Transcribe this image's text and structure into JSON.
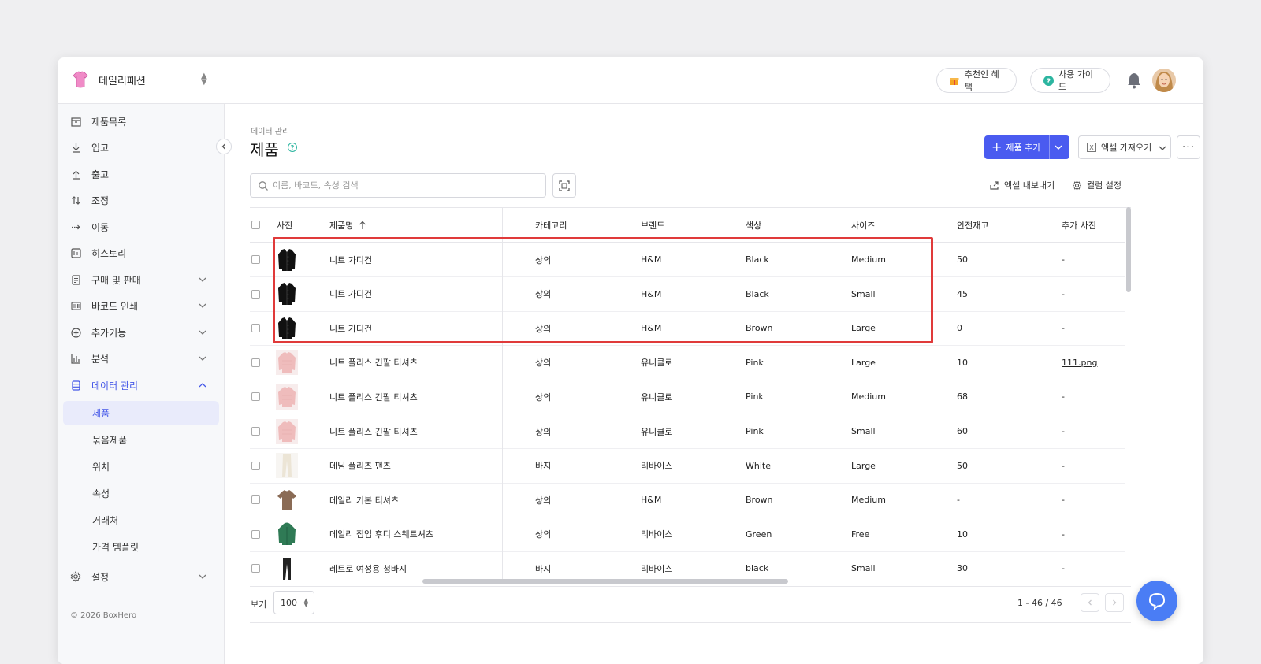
{
  "brand": {
    "name": "데일리패션"
  },
  "topbar": {
    "referral_label": "추천인 혜택",
    "guide_label": "사용 가이드"
  },
  "colors": {
    "accent": "#4a5bf0",
    "highlight": "#e03a3a",
    "help": "#2cb5a0"
  },
  "sidebar": {
    "items": [
      {
        "label": "제품목록",
        "icon": "box-icon"
      },
      {
        "label": "입고",
        "icon": "arrow-down-icon"
      },
      {
        "label": "출고",
        "icon": "arrow-up-icon"
      },
      {
        "label": "조정",
        "icon": "adjust-icon"
      },
      {
        "label": "이동",
        "icon": "move-icon"
      },
      {
        "label": "히스토리",
        "icon": "history-icon"
      },
      {
        "label": "구매 및 판매",
        "icon": "document-icon"
      },
      {
        "label": "바코드 인쇄",
        "icon": "barcode-icon"
      },
      {
        "label": "추가기능",
        "icon": "plus-circle-icon"
      },
      {
        "label": "분석",
        "icon": "chart-icon"
      },
      {
        "label": "데이터 관리",
        "icon": "database-icon"
      }
    ],
    "sub_items": [
      "제품",
      "묶음제품",
      "위치",
      "속성",
      "거래처",
      "가격 템플릿"
    ],
    "settings_label": "설정",
    "copyright": "© 2026 BoxHero"
  },
  "main": {
    "breadcrumb": "데이터 관리",
    "title": "제품",
    "add_button": "제품 추가",
    "import_button": "엑셀 가져오기",
    "search_placeholder": "이름, 바코드, 속성 검색",
    "export_label": "엑셀 내보내기",
    "column_settings_label": "컬럼 설정"
  },
  "table": {
    "headers": [
      "사진",
      "제품명",
      "카테고리",
      "브랜드",
      "색상",
      "사이즈",
      "안전재고",
      "추가 사진"
    ],
    "rows": [
      {
        "name": "니트 가디건",
        "category": "상의",
        "brand": "H&M",
        "color": "Black",
        "size": "Medium",
        "safety": "50",
        "photo": "-",
        "thumb": "black-cardigan"
      },
      {
        "name": "니트 가디건",
        "category": "상의",
        "brand": "H&M",
        "color": "Black",
        "size": "Small",
        "safety": "45",
        "photo": "-",
        "thumb": "black-cardigan"
      },
      {
        "name": "니트 가디건",
        "category": "상의",
        "brand": "H&M",
        "color": "Brown",
        "size": "Large",
        "safety": "0",
        "photo": "-",
        "thumb": "black-cardigan"
      },
      {
        "name": "니트 플리스 긴팔 티셔츠",
        "category": "상의",
        "brand": "유니클로",
        "color": "Pink",
        "size": "Large",
        "safety": "10",
        "photo": "111.png",
        "thumb": "pink-sweater"
      },
      {
        "name": "니트 플리스 긴팔 티셔츠",
        "category": "상의",
        "brand": "유니클로",
        "color": "Pink",
        "size": "Medium",
        "safety": "68",
        "photo": "-",
        "thumb": "pink-sweater"
      },
      {
        "name": "니트 플리스 긴팔 티셔츠",
        "category": "상의",
        "brand": "유니클로",
        "color": "Pink",
        "size": "Small",
        "safety": "60",
        "photo": "-",
        "thumb": "pink-sweater"
      },
      {
        "name": "데님 플리츠 팬츠",
        "category": "바지",
        "brand": "리바이스",
        "color": "White",
        "size": "Large",
        "safety": "50",
        "photo": "-",
        "thumb": "white-pants"
      },
      {
        "name": "데일리 기본 티셔츠",
        "category": "상의",
        "brand": "H&M",
        "color": "Brown",
        "size": "Medium",
        "safety": "-",
        "photo": "-",
        "thumb": "brown-tshirt"
      },
      {
        "name": "데일리 집업 후디 스웨트셔츠",
        "category": "상의",
        "brand": "리바이스",
        "color": "Green",
        "size": "Free",
        "safety": "10",
        "photo": "-",
        "thumb": "green-hoodie"
      },
      {
        "name": "레트로 여성용 청바지",
        "category": "바지",
        "brand": "리바이스",
        "color": "black",
        "size": "Small",
        "safety": "30",
        "photo": "-",
        "thumb": "black-jeans"
      }
    ]
  },
  "footer": {
    "view_label": "보기",
    "page_size": "100",
    "page_info": "1 - 46 / 46"
  }
}
